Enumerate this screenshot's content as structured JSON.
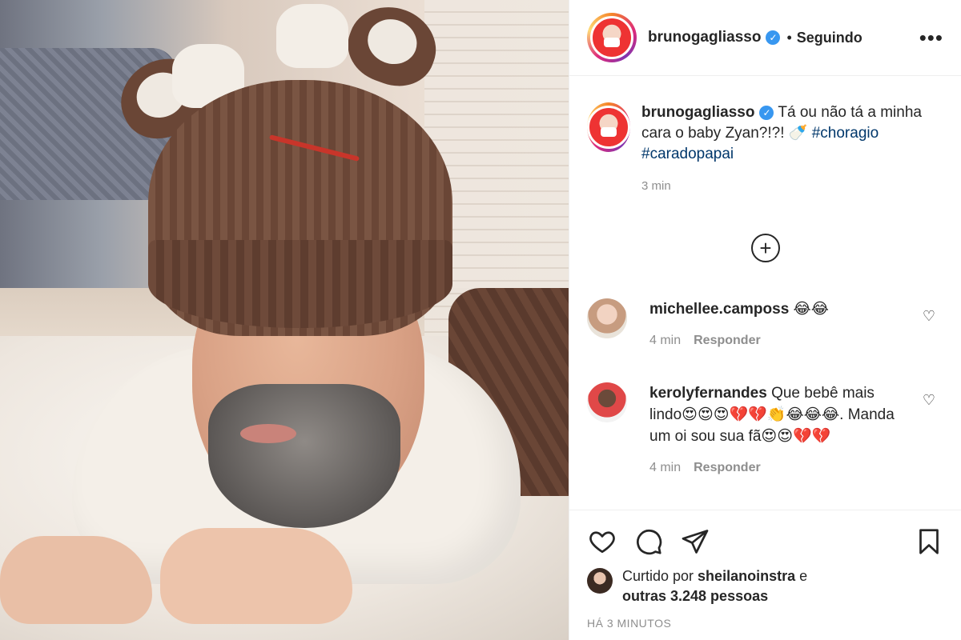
{
  "post": {
    "author": "brunogagliasso",
    "follow_status": "Seguindo",
    "separator": "•",
    "verified_glyph": "✓",
    "more_glyph": "•••",
    "caption": {
      "username": "brunogagliasso",
      "text": " Tá ou não tá a minha cara o baby Zyan?!?! 🍼 ",
      "hashtags": [
        "#choragio",
        "#caradopapai"
      ],
      "time": "3 min"
    },
    "load_more_glyph": "+",
    "comments": [
      {
        "username": "michellee.camposs",
        "text": " 😂😂",
        "time": "4 min",
        "reply": "Responder"
      },
      {
        "username": "kerolyfernandes",
        "text": " Que bebê mais lindo😍😍😍💔💔👏😂😂😂. Manda um oi sou sua fã😍😍💔💔",
        "time": "4 min",
        "reply": "Responder"
      }
    ],
    "likes": {
      "prefix": "Curtido por ",
      "user": "sheilanoinstra",
      "middle": " e ",
      "others": "outras 3.248 pessoas"
    },
    "age": "HÁ 3 MINUTOS"
  },
  "icons": [
    "heart-icon",
    "comment-icon",
    "share-icon",
    "bookmark-icon",
    "more-options-icon",
    "add-circle-icon",
    "verified-icon"
  ]
}
